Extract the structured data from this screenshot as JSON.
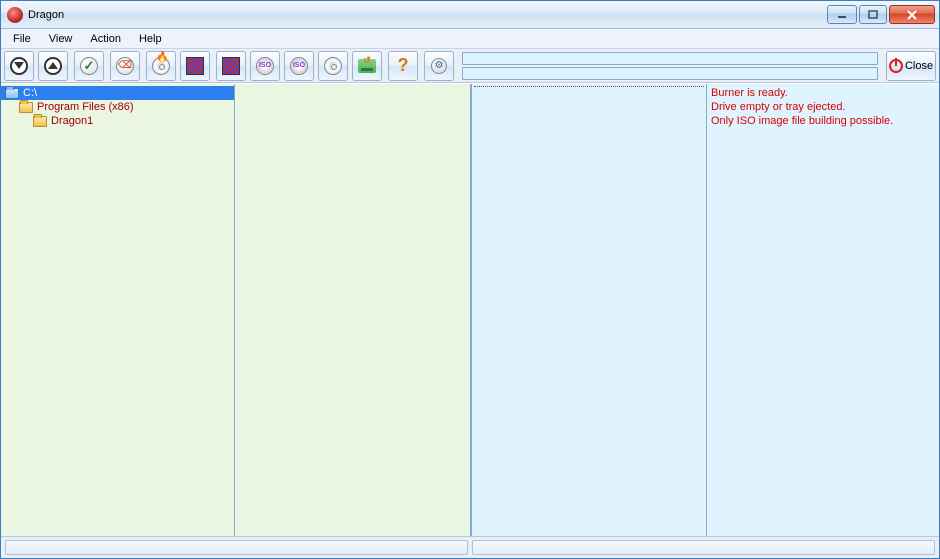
{
  "window": {
    "title": "Dragon"
  },
  "menu": {
    "file": "File",
    "view": "View",
    "action": "Action",
    "help": "Help"
  },
  "toolbar": {
    "close_label": "Close",
    "iso_text": "ISO"
  },
  "tree": {
    "items": [
      {
        "label": "C:\\",
        "selected": true,
        "indent": 0
      },
      {
        "label": "Program Files (x86)",
        "selected": false,
        "indent": 1
      },
      {
        "label": "Dragon1",
        "selected": false,
        "indent": 2
      }
    ]
  },
  "messages": [
    "Burner is ready.",
    "Drive empty or tray ejected.",
    "Only ISO image file building possible."
  ]
}
